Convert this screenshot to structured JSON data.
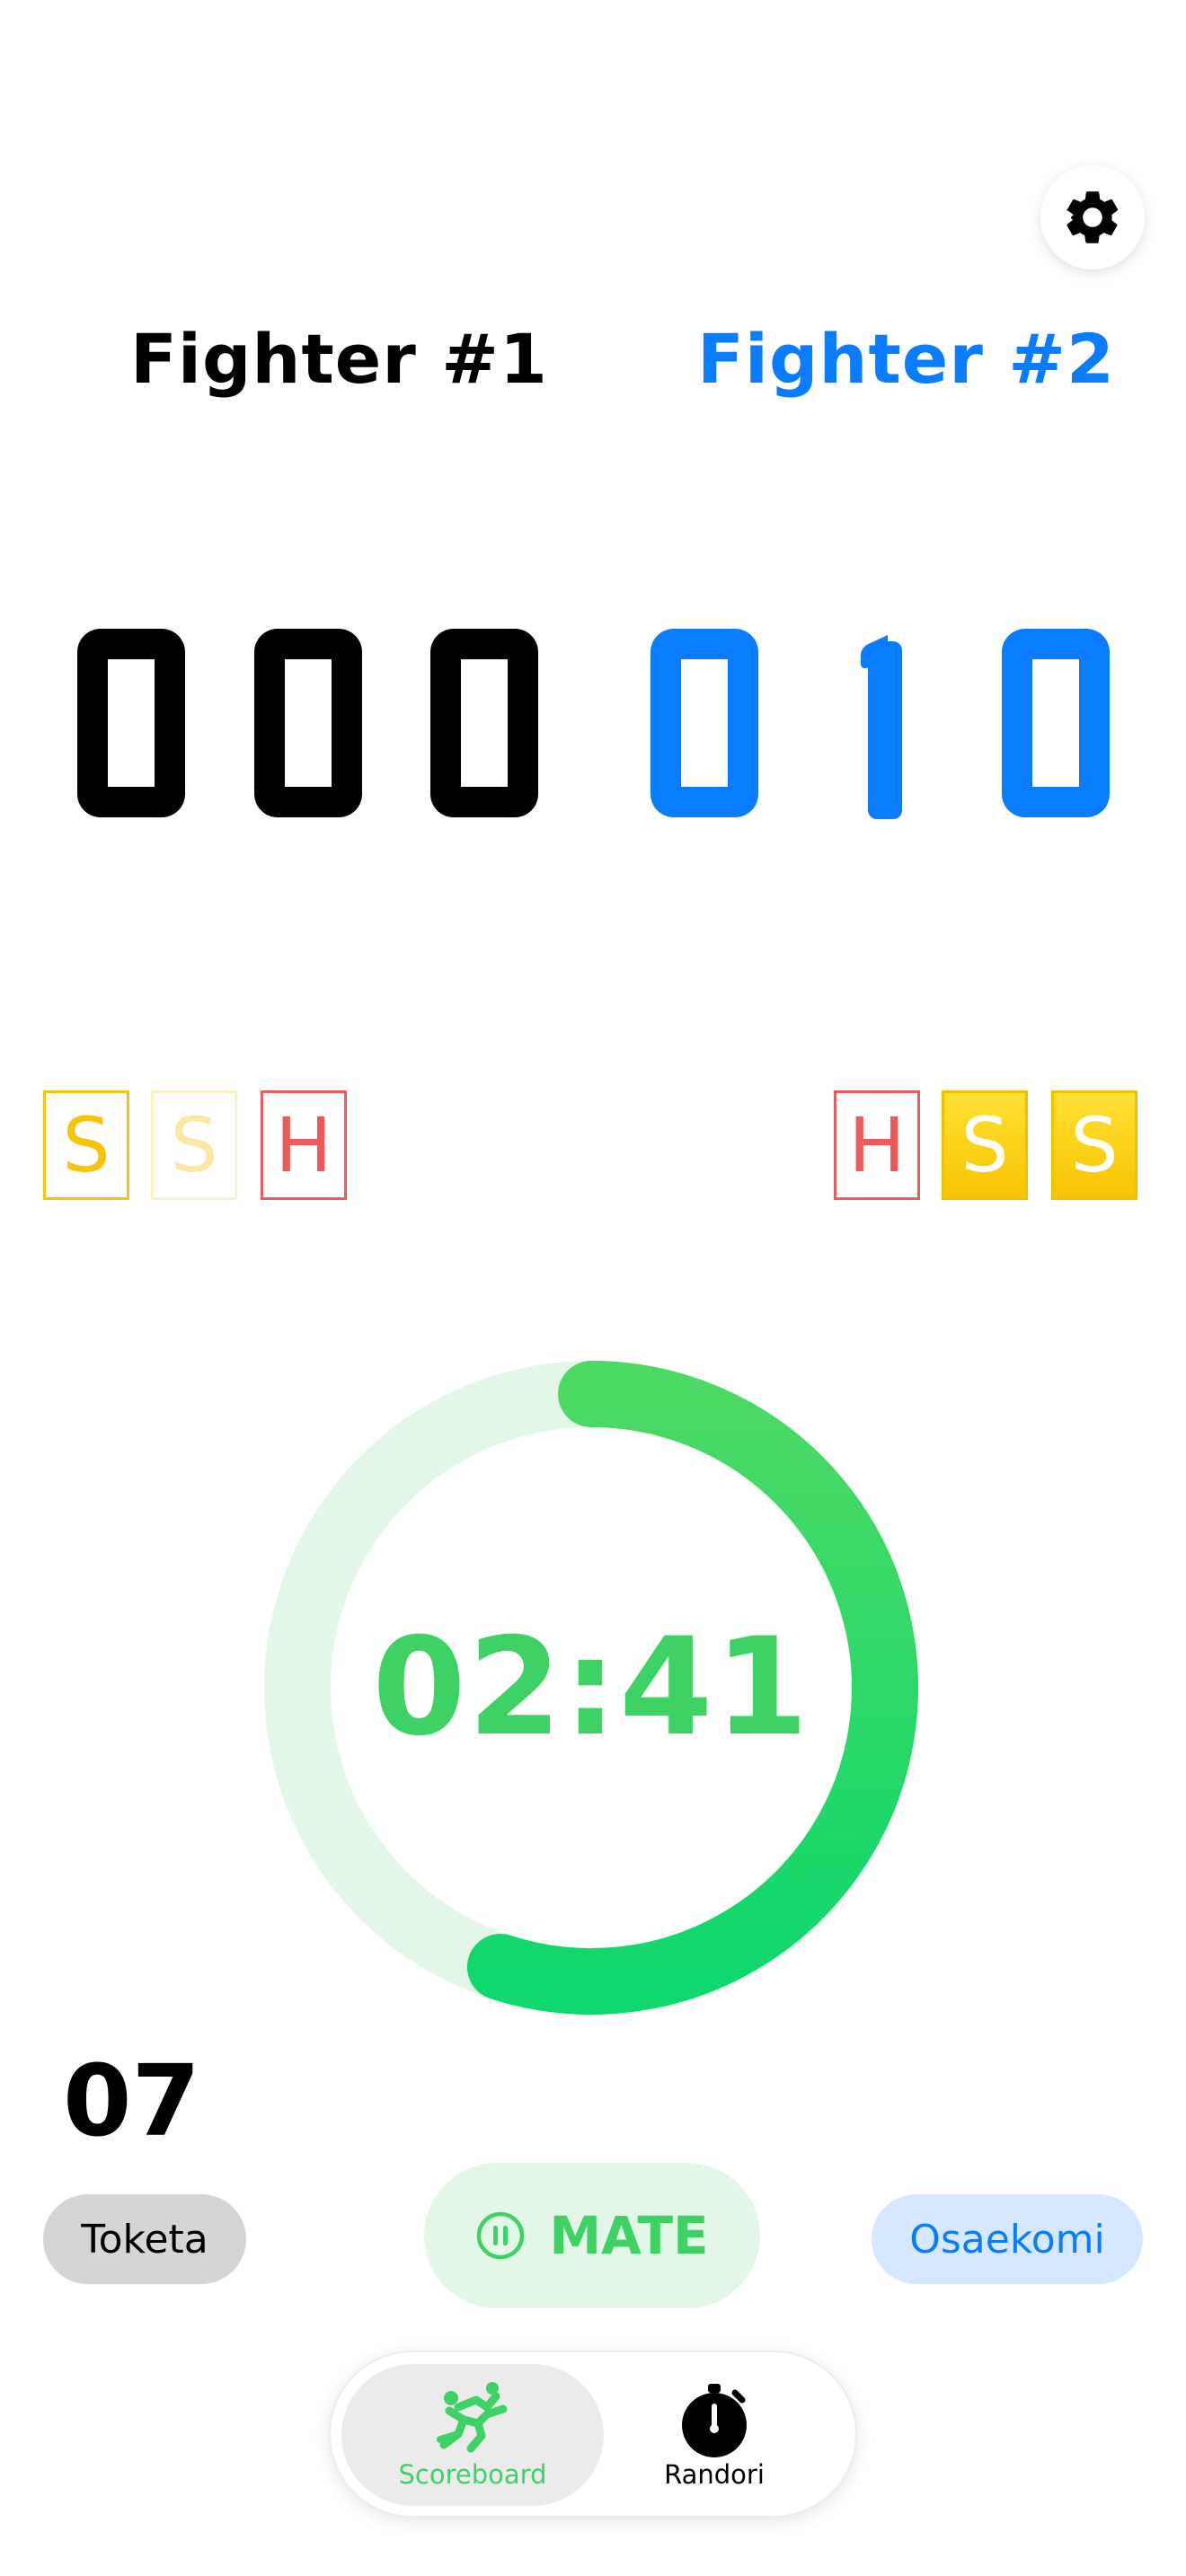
{
  "header": {
    "settings_icon": "gear-icon"
  },
  "fighters": [
    {
      "name": "Fighter #1",
      "color": "#000000",
      "score": [
        "0",
        "0",
        "0"
      ],
      "penalties": [
        {
          "letter": "S",
          "state": "active"
        },
        {
          "letter": "S",
          "state": "faded"
        },
        {
          "letter": "H",
          "state": "outline"
        }
      ]
    },
    {
      "name": "Fighter #2",
      "color": "#0a7cff",
      "score": [
        "0",
        "1",
        "0"
      ],
      "penalties": [
        {
          "letter": "H",
          "state": "outline"
        },
        {
          "letter": "S",
          "state": "filled"
        },
        {
          "letter": "S",
          "state": "filled"
        }
      ]
    }
  ],
  "timer": {
    "text": "02:41",
    "progress_fraction": 0.55,
    "color": "#3dd263"
  },
  "osaekomi_count": "07",
  "actions": {
    "toketa_label": "Toketa",
    "mate_label": "MATE",
    "mate_icon": "pause-circle-icon",
    "osaekomi_label": "Osaekomi"
  },
  "tabs": [
    {
      "label": "Scoreboard",
      "icon": "judo-throw-icon",
      "selected": true
    },
    {
      "label": "Randori",
      "icon": "stopwatch-icon",
      "selected": false
    }
  ]
}
